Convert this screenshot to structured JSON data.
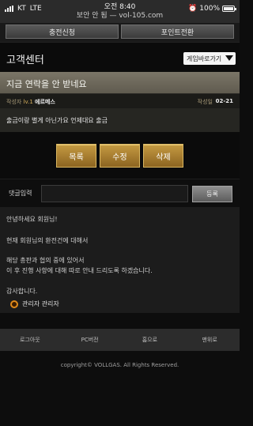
{
  "status_bar": {
    "carrier": "KT",
    "network": "LTE",
    "time": "오전 8:40",
    "site_label": "보안 안 됨 — vol-105.com",
    "battery": "100%"
  },
  "top_tabs": [
    "충전신청",
    "포인트전환"
  ],
  "header": {
    "title": "고객센터",
    "game_select_label": "게임바로가기"
  },
  "post": {
    "title": "지금 연락을 안 받네요",
    "author_label": "작성자",
    "level": "lv.1",
    "author_name": "에르메스",
    "date_label": "작성일",
    "date_value": "02-21",
    "body": "출금이랑 별게 아닌가요 언제대요 출금"
  },
  "actions": {
    "list": "목록",
    "edit": "수정",
    "delete": "삭제"
  },
  "comment": {
    "label": "댓글입력",
    "value": "",
    "register": "등록"
  },
  "reply": {
    "lines": [
      "안녕하세요 회원님!",
      "현재 회원님의 환전건에 대해서",
      "해당 총판과 협의 중에 있어서",
      "이 후 진행 사항에 대해 따로 안내 드리도록 하겠습니다.",
      "감사합니다."
    ],
    "author": "관리자 관리자"
  },
  "footer": {
    "links": [
      "로그아웃",
      "PC버전",
      "홈으로",
      "맨위로"
    ],
    "copyright": "copyright© VOLLGAS. All Rights Reserved."
  },
  "icons": {
    "ring": "admin-ring-icon",
    "select_arrow": "chevron-down-icon"
  },
  "colors": {
    "gold_button": "#b58a34",
    "title_bar": "#6f6a5d",
    "ring": "#e08a1a"
  }
}
